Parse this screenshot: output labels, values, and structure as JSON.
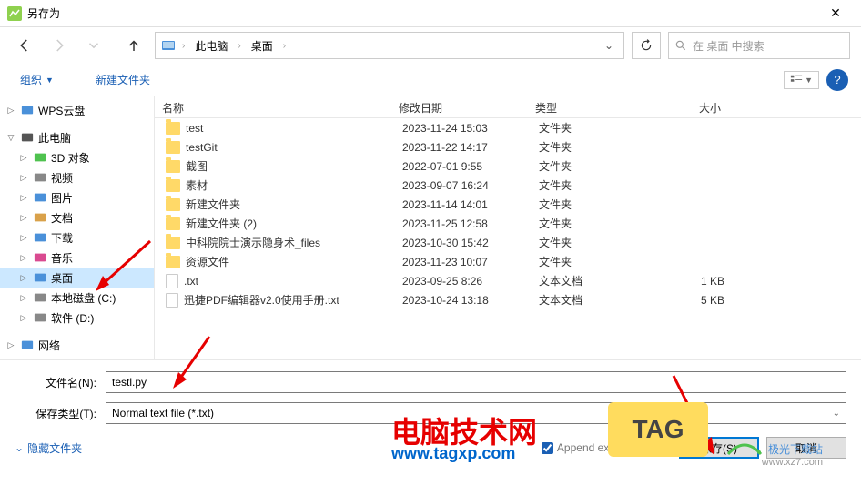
{
  "window": {
    "title": "另存为",
    "close": "✕"
  },
  "breadcrumb": {
    "items": [
      "此电脑",
      "桌面"
    ]
  },
  "search": {
    "placeholder": "在 桌面 中搜索"
  },
  "toolbar": {
    "organize": "组织",
    "new_folder": "新建文件夹"
  },
  "columns": {
    "name": "名称",
    "date": "修改日期",
    "type": "类型",
    "size": "大小"
  },
  "sidebar": {
    "items": [
      {
        "label": "WPS云盘",
        "color": "#4a90d9",
        "indent": 0,
        "exp": "▷"
      },
      {
        "label": "此电脑",
        "color": "#555",
        "indent": 0,
        "exp": "▽",
        "icon": "pc"
      },
      {
        "label": "3D 对象",
        "color": "#555",
        "indent": 1,
        "exp": "▷",
        "icon": "3d"
      },
      {
        "label": "视频",
        "color": "#555",
        "indent": 1,
        "exp": "▷",
        "icon": "video"
      },
      {
        "label": "图片",
        "color": "#555",
        "indent": 1,
        "exp": "▷",
        "icon": "pic"
      },
      {
        "label": "文档",
        "color": "#555",
        "indent": 1,
        "exp": "▷",
        "icon": "doc"
      },
      {
        "label": "下载",
        "color": "#555",
        "indent": 1,
        "exp": "▷",
        "icon": "dl"
      },
      {
        "label": "音乐",
        "color": "#555",
        "indent": 1,
        "exp": "▷",
        "icon": "music"
      },
      {
        "label": "桌面",
        "color": "#555",
        "indent": 1,
        "exp": "▷",
        "icon": "desktop",
        "selected": true
      },
      {
        "label": "本地磁盘 (C:)",
        "color": "#555",
        "indent": 1,
        "exp": "▷",
        "icon": "disk"
      },
      {
        "label": "软件 (D:)",
        "color": "#555",
        "indent": 1,
        "exp": "▷",
        "icon": "disk"
      },
      {
        "label": "网络",
        "color": "#4a90d9",
        "indent": 0,
        "exp": "▷",
        "icon": "net"
      }
    ]
  },
  "files": [
    {
      "name": "test",
      "date": "2023-11-24 15:03",
      "type": "文件夹",
      "size": "",
      "kind": "folder"
    },
    {
      "name": "testGit",
      "date": "2023-11-22 14:17",
      "type": "文件夹",
      "size": "",
      "kind": "folder"
    },
    {
      "name": "截图",
      "date": "2022-07-01 9:55",
      "type": "文件夹",
      "size": "",
      "kind": "folder"
    },
    {
      "name": "素材",
      "date": "2023-09-07 16:24",
      "type": "文件夹",
      "size": "",
      "kind": "folder"
    },
    {
      "name": "新建文件夹",
      "date": "2023-11-14 14:01",
      "type": "文件夹",
      "size": "",
      "kind": "folder"
    },
    {
      "name": "新建文件夹 (2)",
      "date": "2023-11-25 12:58",
      "type": "文件夹",
      "size": "",
      "kind": "folder"
    },
    {
      "name": "中科院院士演示隐身术_files",
      "date": "2023-10-30 15:42",
      "type": "文件夹",
      "size": "",
      "kind": "folder"
    },
    {
      "name": "资源文件",
      "date": "2023-11-23 10:07",
      "type": "文件夹",
      "size": "",
      "kind": "folder"
    },
    {
      "name": ".txt",
      "date": "2023-09-25 8:26",
      "type": "文本文档",
      "size": "1 KB",
      "kind": "file"
    },
    {
      "name": "迅捷PDF编辑器v2.0使用手册.txt",
      "date": "2023-10-24 13:18",
      "type": "文本文档",
      "size": "5 KB",
      "kind": "file"
    }
  ],
  "fields": {
    "filename_label": "文件名(N):",
    "filename_value": "testl.py",
    "filetype_label": "保存类型(T):",
    "filetype_value": "Normal text file (*.txt)"
  },
  "actions": {
    "hide_folders": "隐藏文件夹",
    "append_ext": "Append extension",
    "save": "保存(S)",
    "cancel": "取消"
  },
  "watermark": {
    "title": "电脑技术网",
    "url": "www.tagxp.com",
    "tag": "TAG",
    "logo": "极光下载站",
    "logo_sub": "www.xz7.com"
  }
}
